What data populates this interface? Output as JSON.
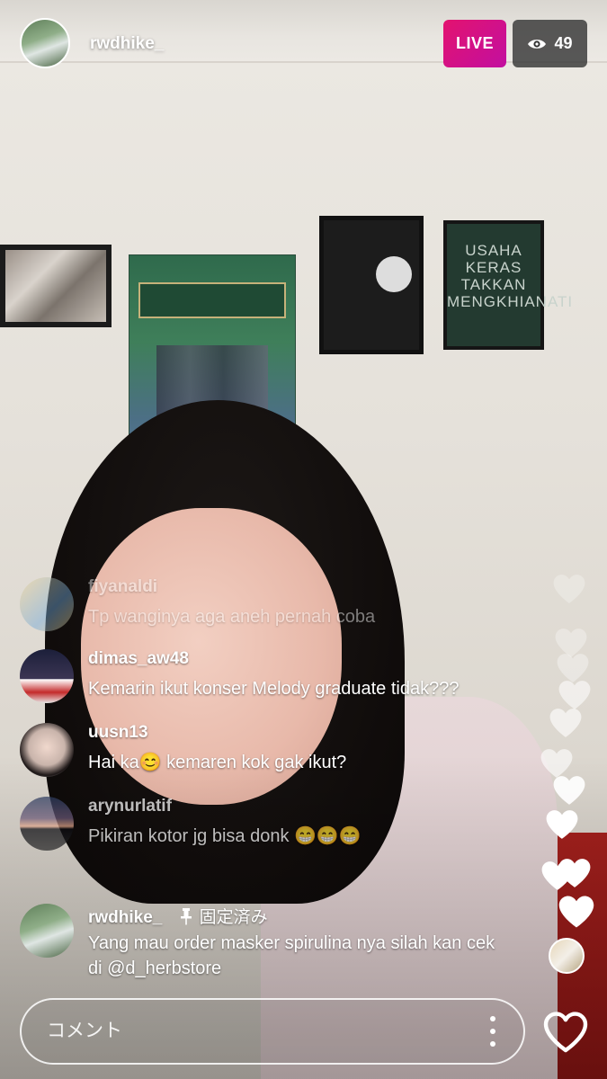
{
  "header": {
    "host_username": "rwdhike_",
    "live_label": "LIVE",
    "viewer_count": "49",
    "live_color": "#e3136f"
  },
  "comments": [
    {
      "username": "fiyanaldi",
      "text": "Tp wanginya aga aneh pernah coba"
    },
    {
      "username": "dimas_aw48",
      "text": "Kemarin ikut konser Melody graduate tidak???"
    },
    {
      "username": "uusn13",
      "text": "Hai ka😊 kemaren kok gak ikut?"
    },
    {
      "username": "arynurlatif",
      "text": "Pikiran kotor jg bisa donk 😁😁😁"
    }
  ],
  "pinned_comment": {
    "username": "rwdhike_",
    "pin_label": "固定済み",
    "text": "Yang mau order masker spirulina nya silah kan cek di @d_herbstore"
  },
  "footer": {
    "comment_placeholder": "コメント"
  },
  "background_text": {
    "poster_quote": "USAHA KERAS TAKKAN MENGKHIANATI"
  }
}
